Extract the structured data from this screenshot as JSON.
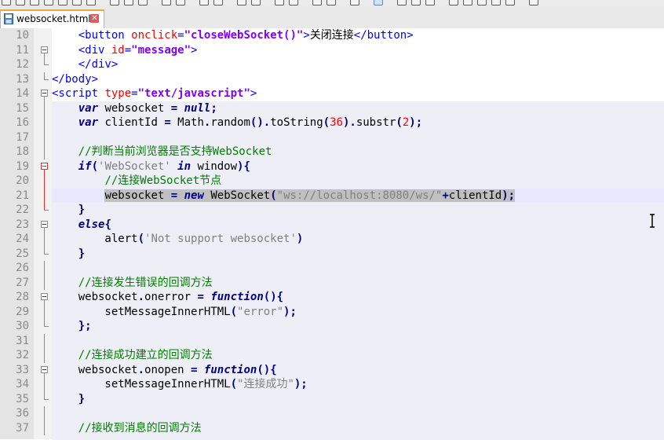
{
  "tab": {
    "label": "websocket.html",
    "close": "✕",
    "icon": "save-disk-icon"
  },
  "colors": {
    "tab_accent": "#f3a541",
    "gutter": "#e4e4e4",
    "scope": "#eeeef6",
    "current_line": "#e8e8ff",
    "selection": "#c0c0c0"
  },
  "editor": {
    "current_line": 21,
    "lines": [
      {
        "n": "10",
        "p": [
          [
            "",
            "    "
          ],
          [
            "tag",
            "<button "
          ],
          [
            "attr",
            "onclick"
          ],
          [
            "tag",
            "="
          ],
          [
            "str",
            "\"closeWebSocket()\""
          ],
          [
            "tag",
            ">"
          ],
          [
            "txt",
            "关闭连接"
          ],
          [
            "tag",
            "</button>"
          ]
        ]
      },
      {
        "n": "11",
        "p": [
          [
            "",
            "    "
          ],
          [
            "tag",
            "<div "
          ],
          [
            "attr",
            "id"
          ],
          [
            "tag",
            "="
          ],
          [
            "str",
            "\"message\""
          ],
          [
            "tag",
            ">"
          ]
        ]
      },
      {
        "n": "12",
        "p": [
          [
            "",
            "    "
          ],
          [
            "tag",
            "</div>"
          ]
        ]
      },
      {
        "n": "13",
        "p": [
          [
            "tag",
            "</body>"
          ]
        ]
      },
      {
        "n": "14",
        "p": [
          [
            "tag",
            "<script "
          ],
          [
            "attr",
            "type"
          ],
          [
            "tag",
            "="
          ],
          [
            "str",
            "\"text/javascript\""
          ],
          [
            "tag",
            ">"
          ]
        ]
      },
      {
        "n": "15",
        "p": [
          [
            "",
            "    "
          ],
          [
            "kw",
            "var"
          ],
          [
            "",
            " websocket "
          ],
          [
            "op",
            "="
          ],
          [
            "",
            " "
          ],
          [
            "kw",
            "null"
          ],
          [
            "op",
            ";"
          ]
        ]
      },
      {
        "n": "16",
        "p": [
          [
            "",
            "    "
          ],
          [
            "kw",
            "var"
          ],
          [
            "",
            " clientId "
          ],
          [
            "op",
            "="
          ],
          [
            "",
            " Math"
          ],
          [
            "op",
            "."
          ],
          [
            "",
            "random"
          ],
          [
            "op",
            "()."
          ],
          [
            "",
            "toString"
          ],
          [
            "op",
            "("
          ],
          [
            "num",
            "36"
          ],
          [
            "op",
            ")."
          ],
          [
            "",
            "substr"
          ],
          [
            "op",
            "("
          ],
          [
            "num",
            "2"
          ],
          [
            "op",
            ");"
          ]
        ]
      },
      {
        "n": "17",
        "p": []
      },
      {
        "n": "18",
        "p": [
          [
            "",
            "    "
          ],
          [
            "cm",
            "//判断当前浏览器是否支持WebSocket"
          ]
        ]
      },
      {
        "n": "19",
        "p": [
          [
            "",
            "    "
          ],
          [
            "kw",
            "if"
          ],
          [
            "op",
            "("
          ],
          [
            "sstr",
            "'WebSocket'"
          ],
          [
            "",
            " "
          ],
          [
            "kw",
            "in"
          ],
          [
            "",
            " window"
          ],
          [
            "op",
            "){"
          ]
        ]
      },
      {
        "n": "20",
        "p": [
          [
            "",
            "        "
          ],
          [
            "cm",
            "//连接WebSocket节点"
          ]
        ]
      },
      {
        "n": "21",
        "p": [
          [
            "",
            "        "
          ],
          [
            "sel",
            "websocket "
          ],
          [
            "sel-op",
            "="
          ],
          [
            "sel",
            " "
          ],
          [
            "sel-kw",
            "new"
          ],
          [
            "sel",
            " WebSocket"
          ],
          [
            "sel-op",
            "("
          ],
          [
            "sel-sstr",
            "\"ws://localhost:8080/ws/\""
          ],
          [
            "sel-op",
            "+"
          ],
          [
            "sel",
            "clientId"
          ],
          [
            "sel-op",
            ");"
          ]
        ]
      },
      {
        "n": "22",
        "p": [
          [
            "",
            "    "
          ],
          [
            "op",
            "}"
          ]
        ]
      },
      {
        "n": "23",
        "p": [
          [
            "",
            "    "
          ],
          [
            "kw",
            "else"
          ],
          [
            "op",
            "{"
          ]
        ]
      },
      {
        "n": "24",
        "p": [
          [
            "",
            "        alert"
          ],
          [
            "op",
            "("
          ],
          [
            "sstr",
            "'Not support websocket'"
          ],
          [
            "op",
            ")"
          ]
        ]
      },
      {
        "n": "25",
        "p": [
          [
            "",
            "    "
          ],
          [
            "op",
            "}"
          ]
        ]
      },
      {
        "n": "26",
        "p": []
      },
      {
        "n": "27",
        "p": [
          [
            "",
            "    "
          ],
          [
            "cm",
            "//连接发生错误的回调方法"
          ]
        ]
      },
      {
        "n": "28",
        "p": [
          [
            "",
            "    websocket"
          ],
          [
            "op",
            "."
          ],
          [
            "",
            "onerror "
          ],
          [
            "op",
            "="
          ],
          [
            "",
            " "
          ],
          [
            "kw",
            "function"
          ],
          [
            "op",
            "(){"
          ]
        ]
      },
      {
        "n": "29",
        "p": [
          [
            "",
            "        setMessageInnerHTML"
          ],
          [
            "op",
            "("
          ],
          [
            "sstr",
            "\"error\""
          ],
          [
            "op",
            ");"
          ]
        ]
      },
      {
        "n": "30",
        "p": [
          [
            "",
            "    "
          ],
          [
            "op",
            "};"
          ]
        ]
      },
      {
        "n": "31",
        "p": []
      },
      {
        "n": "32",
        "p": [
          [
            "",
            "    "
          ],
          [
            "cm",
            "//连接成功建立的回调方法"
          ]
        ]
      },
      {
        "n": "33",
        "p": [
          [
            "",
            "    websocket"
          ],
          [
            "op",
            "."
          ],
          [
            "",
            "onopen "
          ],
          [
            "op",
            "="
          ],
          [
            "",
            " "
          ],
          [
            "kw",
            "function"
          ],
          [
            "op",
            "(){"
          ]
        ]
      },
      {
        "n": "34",
        "p": [
          [
            "",
            "        setMessageInnerHTML"
          ],
          [
            "op",
            "("
          ],
          [
            "sstr",
            "\"连接成功\""
          ],
          [
            "op",
            ");"
          ]
        ]
      },
      {
        "n": "35",
        "p": [
          [
            "",
            "    "
          ],
          [
            "op",
            "}"
          ]
        ]
      },
      {
        "n": "36",
        "p": []
      },
      {
        "n": "37",
        "p": [
          [
            "",
            "    "
          ],
          [
            "cm",
            "//接收到消息的回调方法"
          ]
        ]
      }
    ]
  }
}
